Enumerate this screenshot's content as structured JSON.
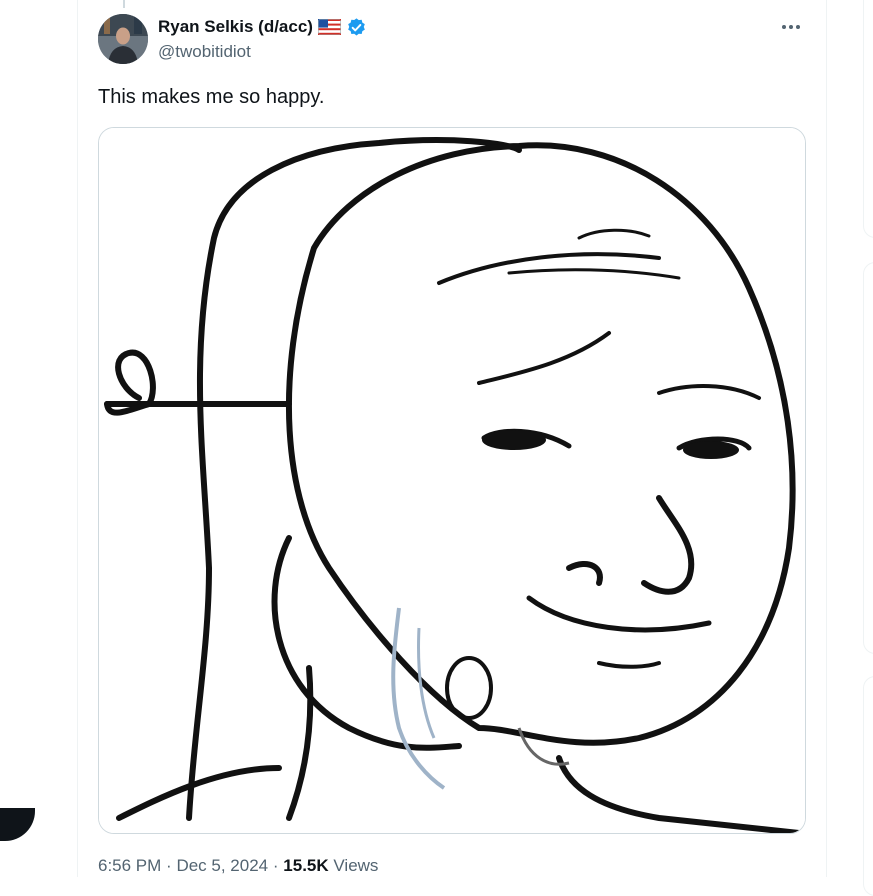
{
  "tweet": {
    "author": {
      "display_name": "Ryan Selkis (d/acc)",
      "handle": "@twobitidiot",
      "badges": [
        "us-flag-icon",
        "verified-badge-icon"
      ]
    },
    "more_icon": "more-dots-icon",
    "text": "This makes me so happy.",
    "media": {
      "type": "meme-drawing",
      "subject": "wojak-smiling-mask"
    },
    "meta": {
      "time": "6:56 PM",
      "separator": "·",
      "date": "Dec 5, 2024",
      "views_count": "15.5K",
      "views_label": "Views"
    }
  },
  "colors": {
    "text_primary": "#0f1419",
    "text_secondary": "#536471",
    "verified": "#1d9bf0",
    "border": "#cfd9de"
  }
}
